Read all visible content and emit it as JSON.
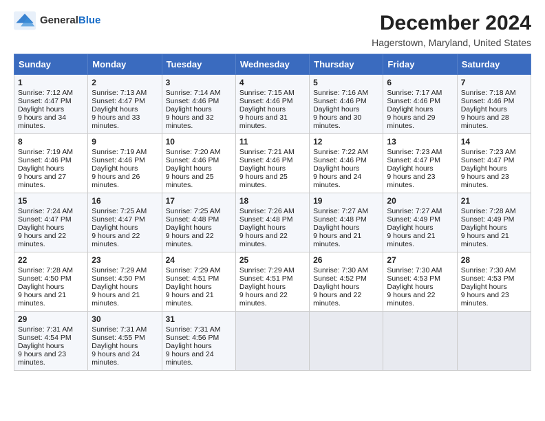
{
  "logo": {
    "general": "General",
    "blue": "Blue"
  },
  "header": {
    "title": "December 2024",
    "subtitle": "Hagerstown, Maryland, United States"
  },
  "days_of_week": [
    "Sunday",
    "Monday",
    "Tuesday",
    "Wednesday",
    "Thursday",
    "Friday",
    "Saturday"
  ],
  "weeks": [
    [
      {
        "day": "1",
        "sunrise": "7:12 AM",
        "sunset": "4:47 PM",
        "daylight": "9 hours and 34 minutes."
      },
      {
        "day": "2",
        "sunrise": "7:13 AM",
        "sunset": "4:47 PM",
        "daylight": "9 hours and 33 minutes."
      },
      {
        "day": "3",
        "sunrise": "7:14 AM",
        "sunset": "4:46 PM",
        "daylight": "9 hours and 32 minutes."
      },
      {
        "day": "4",
        "sunrise": "7:15 AM",
        "sunset": "4:46 PM",
        "daylight": "9 hours and 31 minutes."
      },
      {
        "day": "5",
        "sunrise": "7:16 AM",
        "sunset": "4:46 PM",
        "daylight": "9 hours and 30 minutes."
      },
      {
        "day": "6",
        "sunrise": "7:17 AM",
        "sunset": "4:46 PM",
        "daylight": "9 hours and 29 minutes."
      },
      {
        "day": "7",
        "sunrise": "7:18 AM",
        "sunset": "4:46 PM",
        "daylight": "9 hours and 28 minutes."
      }
    ],
    [
      {
        "day": "8",
        "sunrise": "7:19 AM",
        "sunset": "4:46 PM",
        "daylight": "9 hours and 27 minutes."
      },
      {
        "day": "9",
        "sunrise": "7:19 AM",
        "sunset": "4:46 PM",
        "daylight": "9 hours and 26 minutes."
      },
      {
        "day": "10",
        "sunrise": "7:20 AM",
        "sunset": "4:46 PM",
        "daylight": "9 hours and 25 minutes."
      },
      {
        "day": "11",
        "sunrise": "7:21 AM",
        "sunset": "4:46 PM",
        "daylight": "9 hours and 25 minutes."
      },
      {
        "day": "12",
        "sunrise": "7:22 AM",
        "sunset": "4:46 PM",
        "daylight": "9 hours and 24 minutes."
      },
      {
        "day": "13",
        "sunrise": "7:23 AM",
        "sunset": "4:47 PM",
        "daylight": "9 hours and 23 minutes."
      },
      {
        "day": "14",
        "sunrise": "7:23 AM",
        "sunset": "4:47 PM",
        "daylight": "9 hours and 23 minutes."
      }
    ],
    [
      {
        "day": "15",
        "sunrise": "7:24 AM",
        "sunset": "4:47 PM",
        "daylight": "9 hours and 22 minutes."
      },
      {
        "day": "16",
        "sunrise": "7:25 AM",
        "sunset": "4:47 PM",
        "daylight": "9 hours and 22 minutes."
      },
      {
        "day": "17",
        "sunrise": "7:25 AM",
        "sunset": "4:48 PM",
        "daylight": "9 hours and 22 minutes."
      },
      {
        "day": "18",
        "sunrise": "7:26 AM",
        "sunset": "4:48 PM",
        "daylight": "9 hours and 22 minutes."
      },
      {
        "day": "19",
        "sunrise": "7:27 AM",
        "sunset": "4:48 PM",
        "daylight": "9 hours and 21 minutes."
      },
      {
        "day": "20",
        "sunrise": "7:27 AM",
        "sunset": "4:49 PM",
        "daylight": "9 hours and 21 minutes."
      },
      {
        "day": "21",
        "sunrise": "7:28 AM",
        "sunset": "4:49 PM",
        "daylight": "9 hours and 21 minutes."
      }
    ],
    [
      {
        "day": "22",
        "sunrise": "7:28 AM",
        "sunset": "4:50 PM",
        "daylight": "9 hours and 21 minutes."
      },
      {
        "day": "23",
        "sunrise": "7:29 AM",
        "sunset": "4:50 PM",
        "daylight": "9 hours and 21 minutes."
      },
      {
        "day": "24",
        "sunrise": "7:29 AM",
        "sunset": "4:51 PM",
        "daylight": "9 hours and 21 minutes."
      },
      {
        "day": "25",
        "sunrise": "7:29 AM",
        "sunset": "4:51 PM",
        "daylight": "9 hours and 22 minutes."
      },
      {
        "day": "26",
        "sunrise": "7:30 AM",
        "sunset": "4:52 PM",
        "daylight": "9 hours and 22 minutes."
      },
      {
        "day": "27",
        "sunrise": "7:30 AM",
        "sunset": "4:53 PM",
        "daylight": "9 hours and 22 minutes."
      },
      {
        "day": "28",
        "sunrise": "7:30 AM",
        "sunset": "4:53 PM",
        "daylight": "9 hours and 23 minutes."
      }
    ],
    [
      {
        "day": "29",
        "sunrise": "7:31 AM",
        "sunset": "4:54 PM",
        "daylight": "9 hours and 23 minutes."
      },
      {
        "day": "30",
        "sunrise": "7:31 AM",
        "sunset": "4:55 PM",
        "daylight": "9 hours and 24 minutes."
      },
      {
        "day": "31",
        "sunrise": "7:31 AM",
        "sunset": "4:56 PM",
        "daylight": "9 hours and 24 minutes."
      },
      null,
      null,
      null,
      null
    ]
  ]
}
